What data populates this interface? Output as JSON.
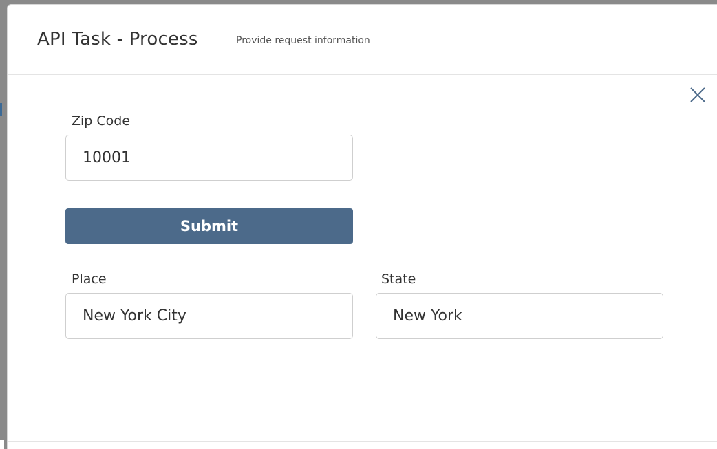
{
  "modal": {
    "title": "API Task - Process",
    "subtitle": "Provide request information",
    "close_icon": "close-icon"
  },
  "form": {
    "zip": {
      "label": "Zip Code",
      "value": "10001"
    },
    "submit_label": "Submit",
    "place": {
      "label": "Place",
      "value": "New York City"
    },
    "state": {
      "label": "State",
      "value": "New York"
    }
  },
  "colors": {
    "primary_button": "#4c6a8a",
    "text": "#333333",
    "border": "#cfcfcf"
  }
}
